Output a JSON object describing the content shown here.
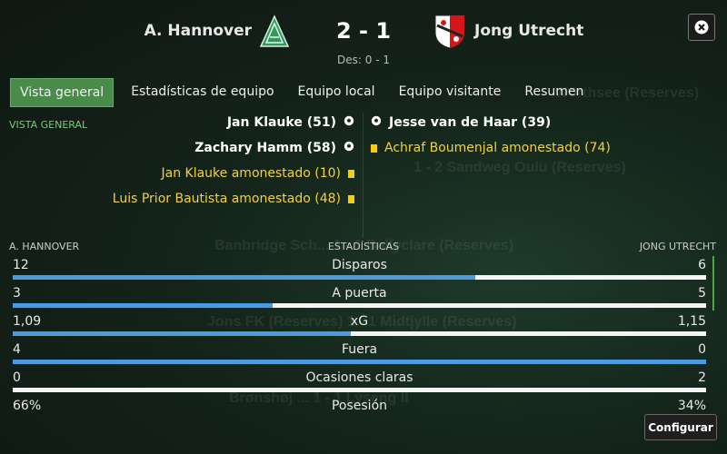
{
  "match": {
    "home_team": "A. Hannover",
    "away_team": "Jong Utrecht",
    "score": "2 - 1",
    "halftime": "Des: 0 - 1"
  },
  "tabs": [
    {
      "label": "Vista general",
      "active": true
    },
    {
      "label": "Estadísticas de equipo",
      "active": false
    },
    {
      "label": "Equipo local",
      "active": false
    },
    {
      "label": "Equipo visitante",
      "active": false
    },
    {
      "label": "Resumen",
      "active": false
    }
  ],
  "section_label": "VISTA GENERAL",
  "events": {
    "home": [
      {
        "text": "Jan Klauke (51)",
        "type": "goal",
        "icon": "ball-icon"
      },
      {
        "text": "Zachary Hamm (58)",
        "type": "goal",
        "icon": "ball-icon"
      },
      {
        "text": "Jan Klauke amonestado (10)",
        "type": "yellow",
        "icon": "yellow-card-icon"
      },
      {
        "text": "Luis Prior Bautista amonestado (48)",
        "type": "yellow",
        "icon": "yellow-card-icon"
      }
    ],
    "away": [
      {
        "text": "Jesse van de Haar (39)",
        "type": "goal",
        "icon": "ball-icon"
      },
      {
        "text": "Achraf Boumenjal amonestado (74)",
        "type": "yellow",
        "icon": "yellow-card-icon"
      }
    ]
  },
  "stats": {
    "home_label": "A. HANNOVER",
    "title": "ESTADÍSTICAS",
    "away_label": "JONG UTRECHT",
    "rows": [
      {
        "name": "Disparos",
        "home": "12",
        "away": "6",
        "home_share": 0.667
      },
      {
        "name": "A puerta",
        "home": "3",
        "away": "5",
        "home_share": 0.375
      },
      {
        "name": "xG",
        "home": "1,09",
        "away": "1,15",
        "home_share": 0.487
      },
      {
        "name": "Fuera",
        "home": "4",
        "away": "0",
        "home_share": 1.0
      },
      {
        "name": "Ocasiones claras",
        "home": "0",
        "away": "2",
        "home_share": 0.0
      },
      {
        "name": "Posesión",
        "home": "66%",
        "away": "34%"
      }
    ]
  },
  "buttons": {
    "close_icon": "close-icon",
    "configure": "Configurar"
  },
  "colors": {
    "accent_green": "#4a8a4a",
    "bar_home": "#4c9be0",
    "bar_away": "#f4f4f4",
    "card_text": "#f1d23a"
  },
  "background_text": [
    "Wörthsee (Reserves)",
    "1 - 2   Sandweg Oulu (Reserves)",
    "Banbridge Sch...   1 - 1   Ballyclare (Reserves)",
    "Jons FK (Reserves)   1 - 1   Midtjylle (Reserves)",
    "Brønshøj ...   1 - 1   Lyseng II"
  ]
}
